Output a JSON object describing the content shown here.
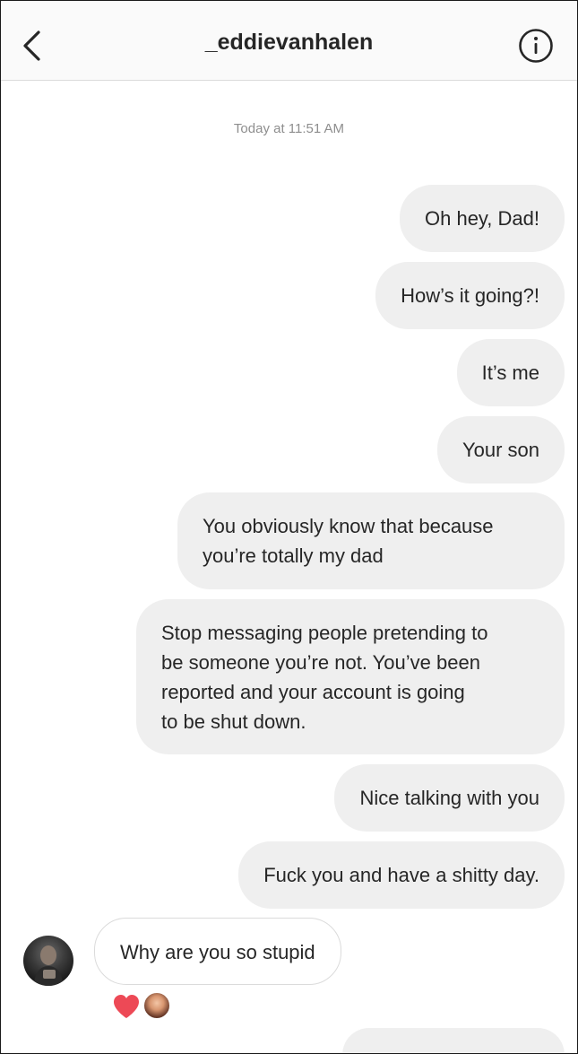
{
  "header": {
    "title": "_eddievanhalen",
    "back_icon": "chevron-left-icon",
    "info_icon": "info-icon"
  },
  "thread": {
    "timestamp": "Today at 11:51 AM",
    "sent": [
      {
        "lines": [
          "Oh hey, Dad!"
        ]
      },
      {
        "lines": [
          "How’s it going?!"
        ]
      },
      {
        "lines": [
          "It’s me"
        ]
      },
      {
        "lines": [
          "Your son"
        ]
      },
      {
        "lines": [
          "You obviously know that because",
          "you’re totally my dad"
        ]
      },
      {
        "lines": [
          "Stop messaging people pretending to",
          "be someone you’re not. You’ve been",
          "reported and your account is going",
          "to be shut down."
        ]
      },
      {
        "lines": [
          "Nice talking with you"
        ]
      },
      {
        "lines": [
          "Fuck you and have a shitty day."
        ]
      }
    ],
    "received": {
      "text": "Why are you so stupid",
      "reactions": [
        "heart-icon",
        "reactor-avatar"
      ]
    }
  },
  "colors": {
    "sent_bubble": "#efefef",
    "received_border": "#dbdbdb",
    "timestamp": "#8e8e8e",
    "heart": "#ed4956"
  }
}
